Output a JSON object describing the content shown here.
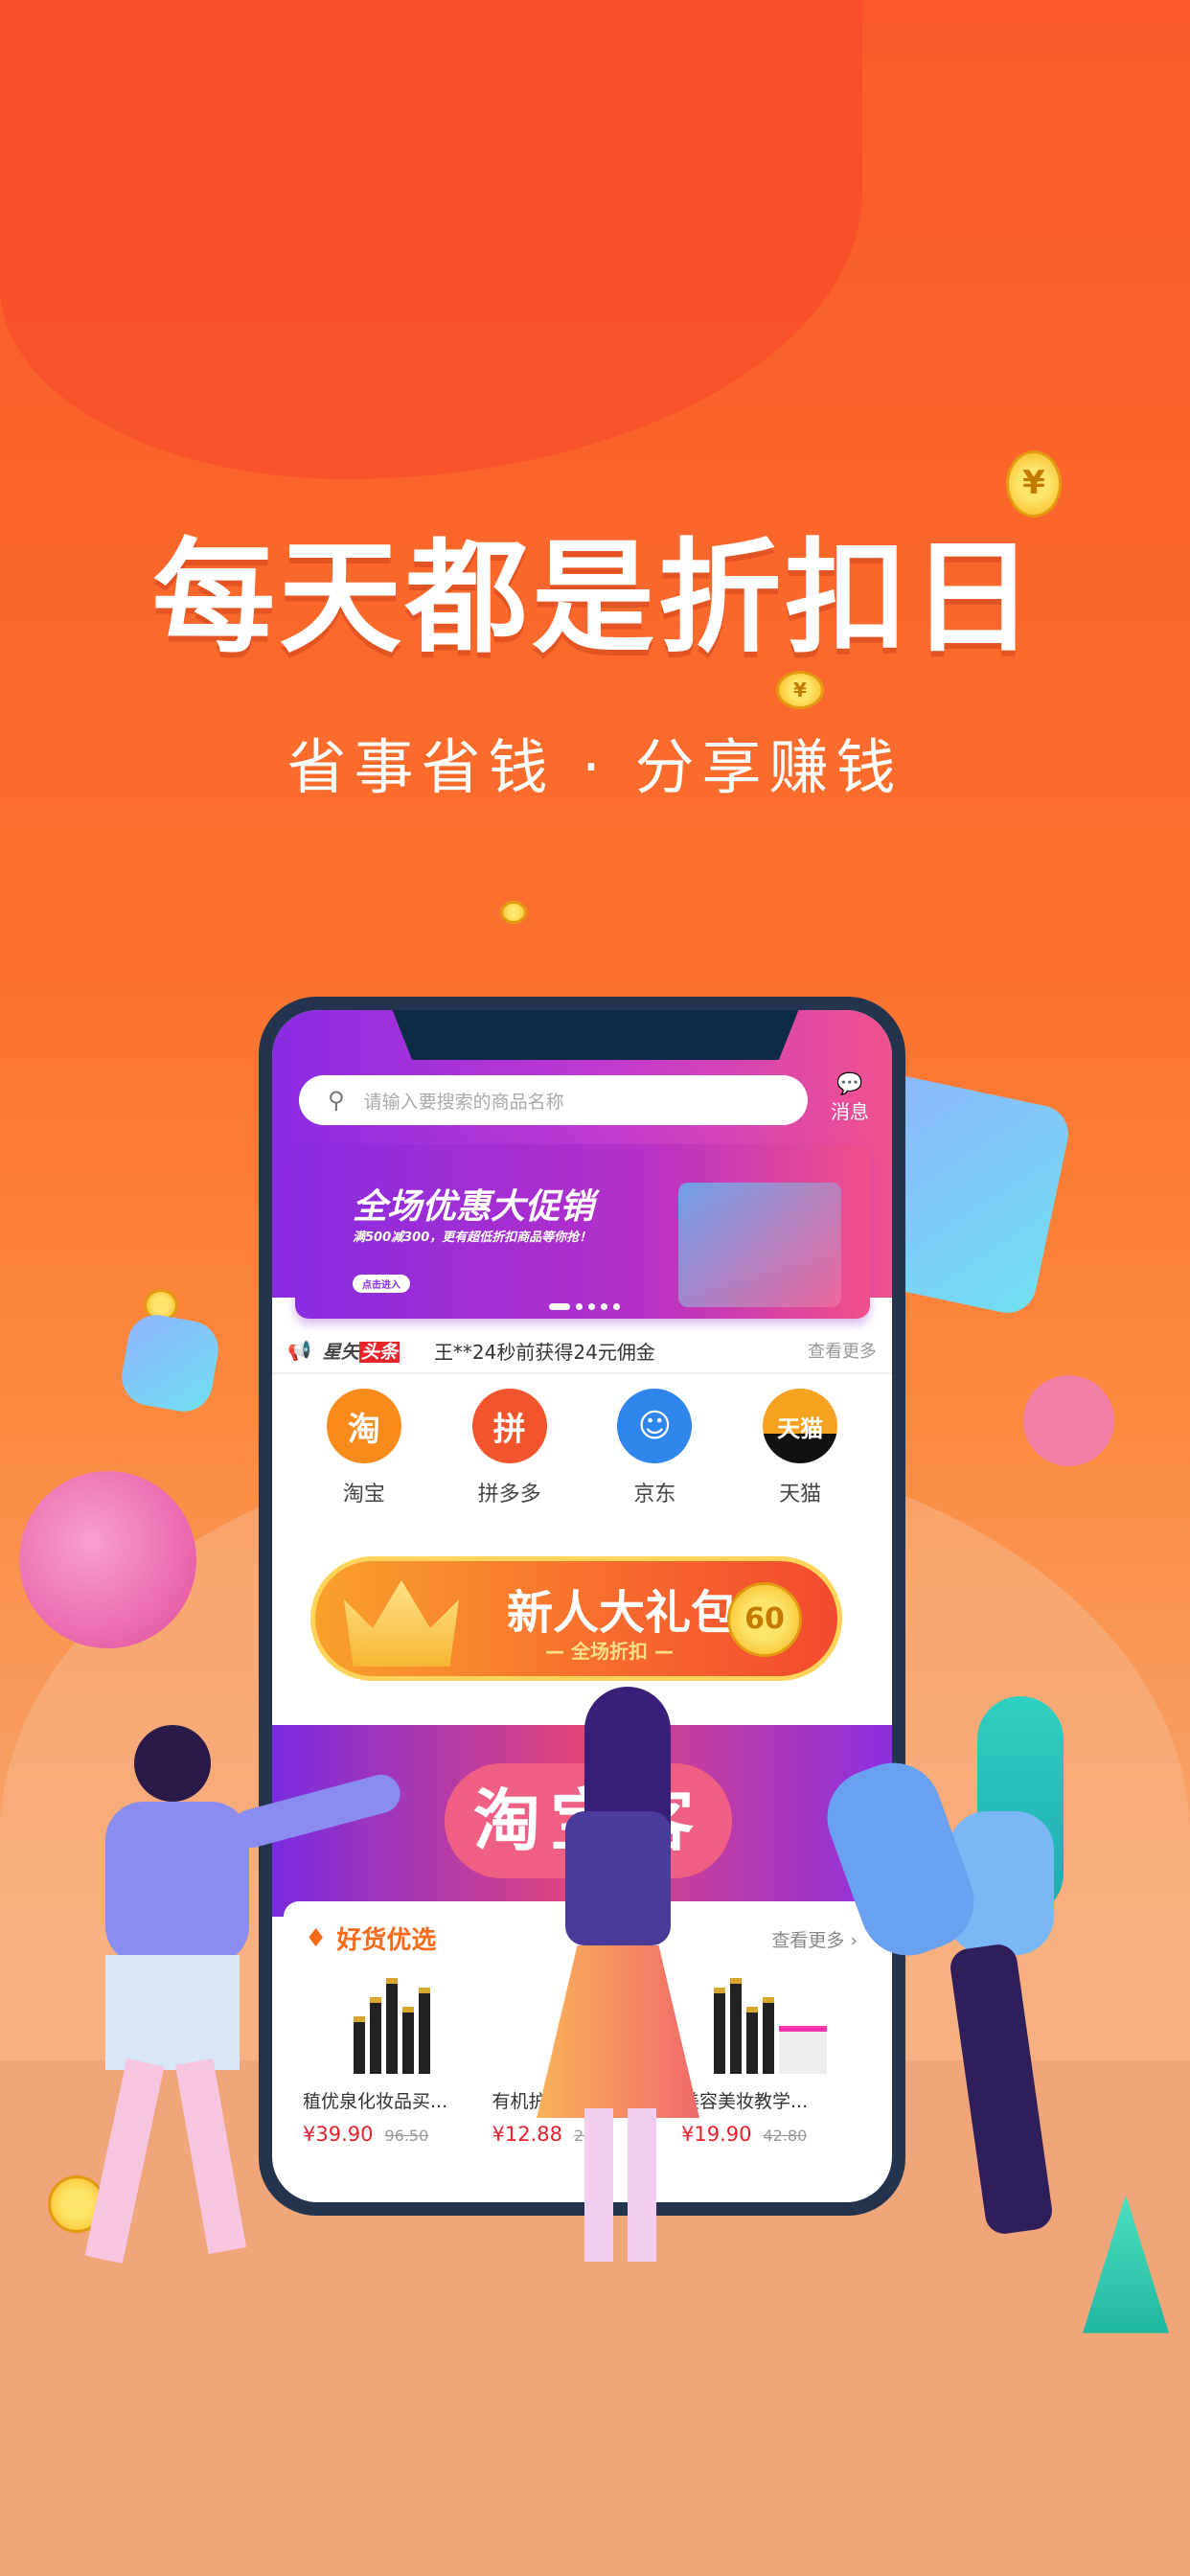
{
  "hero": {
    "title": "每天都是折扣日",
    "subtitle": "省事省钱 · 分享赚钱",
    "coin_symbol": "¥"
  },
  "app": {
    "search": {
      "placeholder": "请输入要搜索的商品名称"
    },
    "messages_label": "消息",
    "banner": {
      "title": "全场优惠大促销",
      "subtitle": "满500减300，更有超低折扣商品等你抢！",
      "button": "点击进入",
      "active_slide": 1,
      "slide_count": 5
    },
    "ticker": {
      "brand": "星矢",
      "brand_badge": "头条",
      "text": "王**24秒前获得24元佣金",
      "more": "查看更多"
    },
    "platforms": [
      {
        "label": "淘宝",
        "glyph": "淘",
        "color": "#f98a1c"
      },
      {
        "label": "拼多多",
        "glyph": "拼",
        "color": "#f2552c"
      },
      {
        "label": "京东",
        "glyph": "☺",
        "color": "#2e86ec"
      },
      {
        "label": "天猫",
        "glyph": "天猫",
        "color": "#f6a221"
      }
    ],
    "gift": {
      "title": "新人大礼包",
      "subtitle": "— 全场折扣 —",
      "badge": "60"
    },
    "taobaoke": {
      "title": "淘宝客"
    },
    "goods": {
      "title": "好货优选",
      "more": "查看更多 ›",
      "items": [
        {
          "name": "稙优泉化妆品买...",
          "price": "¥39.90",
          "original": "96.50"
        },
        {
          "name": "有机护肤彩妆...",
          "price": "¥12.88",
          "original": "26."
        },
        {
          "name": "美容美妆教学...",
          "price": "¥19.90",
          "original": "42.80"
        }
      ]
    }
  }
}
